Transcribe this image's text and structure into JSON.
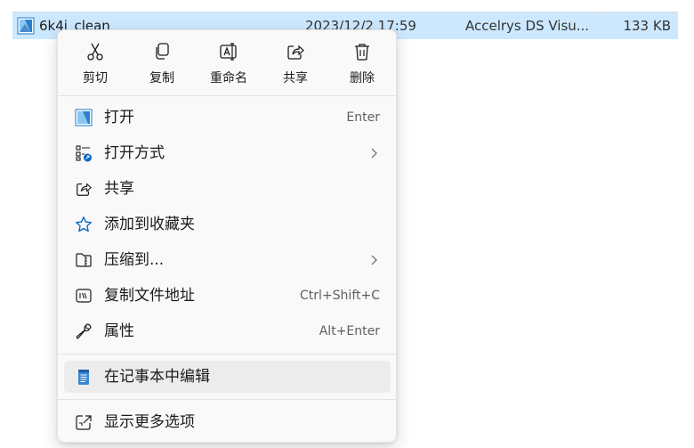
{
  "file": {
    "name": "6k4i_clean",
    "date": "2023/12/2 17:59",
    "type": "Accelrys DS Visu...",
    "size": "133 KB",
    "icon": "ds-visualizer-file-icon"
  },
  "quick_actions": [
    {
      "label": "剪切",
      "icon": "scissors-icon"
    },
    {
      "label": "复制",
      "icon": "copy-icon"
    },
    {
      "label": "重命名",
      "icon": "rename-icon"
    },
    {
      "label": "共享",
      "icon": "share-icon"
    },
    {
      "label": "删除",
      "icon": "trash-icon"
    }
  ],
  "menu_items": [
    {
      "label": "打开",
      "shortcut": "Enter",
      "icon": "ds-visualizer-app-icon"
    },
    {
      "label": "打开方式",
      "shortcut": "",
      "icon": "open-with-icon",
      "submenu": true
    },
    {
      "label": "共享",
      "shortcut": "",
      "icon": "share-icon"
    },
    {
      "label": "添加到收藏夹",
      "shortcut": "",
      "icon": "star-icon"
    },
    {
      "label": "压缩到...",
      "shortcut": "",
      "icon": "zip-folder-icon",
      "submenu": true
    },
    {
      "label": "复制文件地址",
      "shortcut": "Ctrl+Shift+C",
      "icon": "copy-path-icon"
    },
    {
      "label": "属性",
      "shortcut": "Alt+Enter",
      "icon": "wrench-icon"
    },
    {
      "label": "在记事本中编辑",
      "shortcut": "",
      "icon": "notepad-icon"
    },
    {
      "label": "显示更多选项",
      "shortcut": "",
      "icon": "show-more-icon"
    }
  ],
  "colors": {
    "selection": "#cce8ff",
    "accent": "#0067c0",
    "menu_bg": "#f9f9f9"
  }
}
